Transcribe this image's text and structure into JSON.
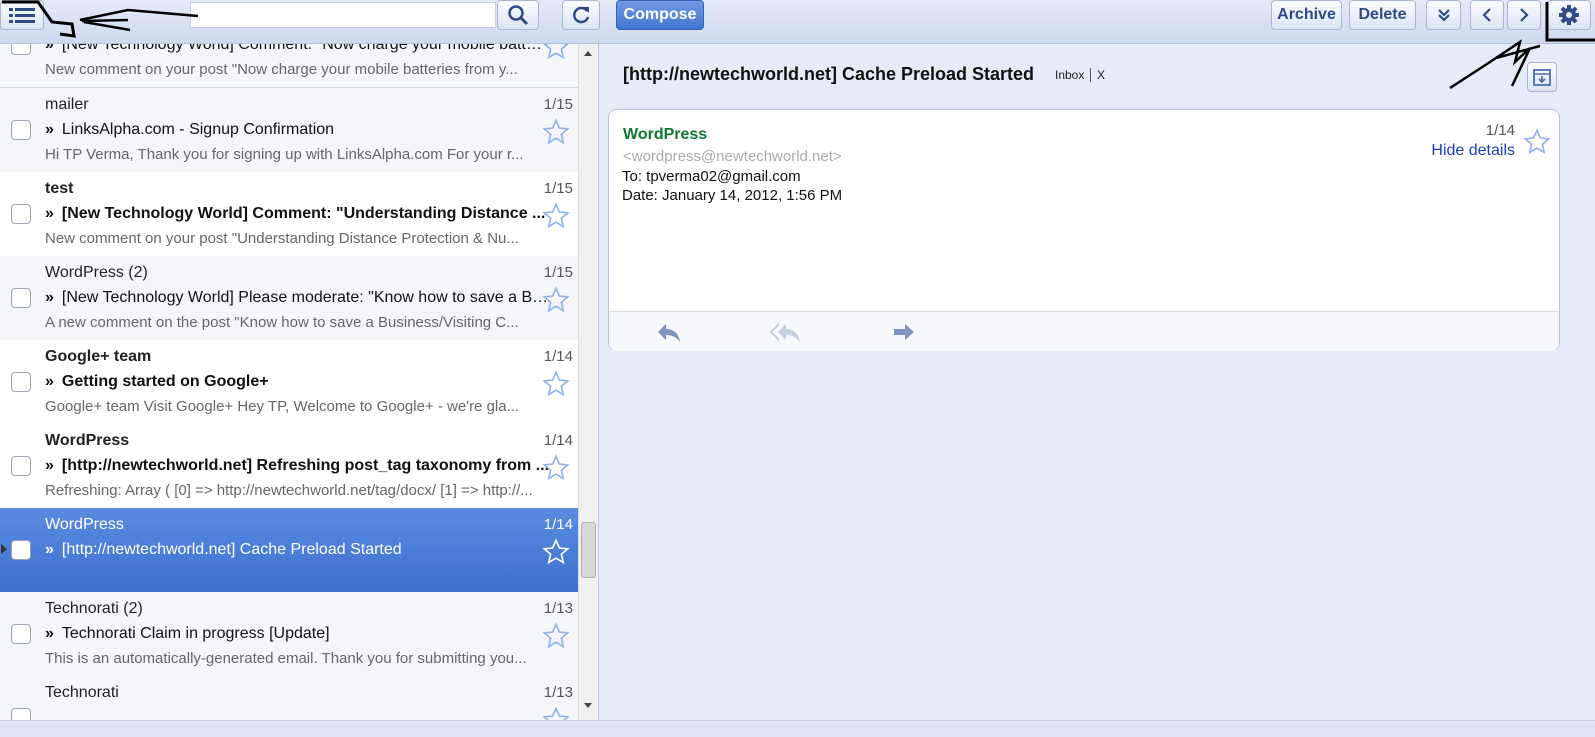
{
  "toolbar": {
    "compose_label": "Compose",
    "archive_label": "Archive",
    "delete_label": "Delete"
  },
  "messages": [
    {
      "sender": "",
      "date": "",
      "subject": "[New Technology World] Comment: \"Now charge your mobile batteries from your...",
      "snippet": "New comment on your post \"Now charge your mobile batteries from y...",
      "state": "read"
    },
    {
      "sender": "mailer",
      "date": "1/15",
      "subject": "LinksAlpha.com - Signup Confirmation",
      "snippet": "Hi TP Verma, Thank you for signing up with LinksAlpha.com For your r...",
      "state": "read"
    },
    {
      "sender": "test",
      "date": "1/15",
      "subject": "[New Technology World] Comment: \"Understanding Distance ...",
      "snippet": "New comment on your post \"Understanding Distance Protection & Nu...",
      "state": "unread"
    },
    {
      "sender": "WordPress (2)",
      "date": "1/15",
      "subject": "[New Technology World] Please moderate: \"Know how to save a Bu...",
      "snippet": "A new comment on the post \"Know how to save a Business/Visiting C...",
      "state": "read"
    },
    {
      "sender": "Google+ team",
      "date": "1/14",
      "subject": "Getting started on Google+",
      "snippet": "Google+ team Visit Google+ Hey TP, Welcome to Google+ - we're gla...",
      "state": "unread"
    },
    {
      "sender": "WordPress",
      "date": "1/14",
      "subject": "[http://newtechworld.net] Refreshing post_tag taxonomy from ...",
      "snippet": "Refreshing: Array ( [0] => http://newtechworld.net/tag/docx/ [1] => http://...",
      "state": "unread"
    },
    {
      "sender": "WordPress",
      "date": "1/14",
      "subject": "[http://newtechworld.net] Cache Preload Started",
      "snippet": "",
      "state": "selected"
    },
    {
      "sender": "Technorati (2)",
      "date": "1/13",
      "subject": "Technorati Claim in progress [Update]",
      "snippet": "This is an automatically-generated email. Thank you for submitting you...",
      "state": "read"
    },
    {
      "sender": "Technorati",
      "date": "1/13",
      "subject": "",
      "snippet": "",
      "state": "read"
    }
  ],
  "reading": {
    "title": "[http://newtechworld.net] Cache Preload Started",
    "label_inbox": "Inbox",
    "label_remove": "X",
    "from_name": "WordPress",
    "from_email": "<wordpress@newtechworld.net>",
    "to_line": "To: tpverma02@gmail.com",
    "date_line": "Date: January 14, 2012, 1:56 PM",
    "card_date": "1/14",
    "hide_details": "Hide details"
  },
  "colors": {
    "accent": "#4476d2",
    "sender_green": "#0c7a2e",
    "link_blue": "#1a3fbf",
    "star_outline": "#8fb0ee"
  },
  "icons": [
    "menu-icon",
    "search-icon",
    "refresh-icon",
    "expand-more-icon",
    "prev-icon",
    "next-icon",
    "settings-gear-icon",
    "star-icon",
    "save-to-icon",
    "reply-icon",
    "reply-all-icon",
    "forward-icon"
  ]
}
